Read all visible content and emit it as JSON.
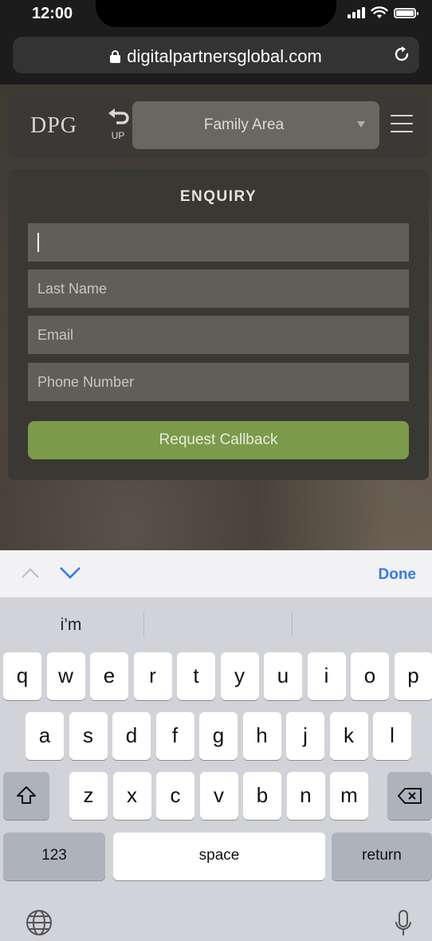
{
  "status_bar": {
    "time": "12:00"
  },
  "browser": {
    "url": "digitalpartnersglobal.com"
  },
  "site": {
    "logo": "DPG",
    "up_label": "UP",
    "section_select": {
      "selected": "Family Area"
    }
  },
  "enquiry": {
    "title": "ENQUIRY",
    "fields": {
      "first_name": {
        "value": "",
        "placeholder": ""
      },
      "last_name": {
        "placeholder": "Last Name"
      },
      "email": {
        "placeholder": "Email"
      },
      "phone": {
        "placeholder": "Phone Number"
      }
    },
    "submit_label": "Request Callback"
  },
  "keyboard": {
    "done_label": "Done",
    "suggestions": [
      "i’m",
      "",
      ""
    ],
    "row1": [
      "q",
      "w",
      "e",
      "r",
      "t",
      "y",
      "u",
      "i",
      "o",
      "p"
    ],
    "row2": [
      "a",
      "s",
      "d",
      "f",
      "g",
      "h",
      "j",
      "k",
      "l"
    ],
    "row3": [
      "z",
      "x",
      "c",
      "v",
      "b",
      "n",
      "m"
    ],
    "numbers_label": "123",
    "space_label": "space",
    "return_label": "return",
    "icons": [
      "shift-icon",
      "backspace-icon",
      "globe-icon",
      "microphone-icon",
      "chevron-up-icon",
      "chevron-down-icon"
    ]
  },
  "colors": {
    "accent_green": "#7b9a4a",
    "ios_blue": "#3478f6"
  }
}
